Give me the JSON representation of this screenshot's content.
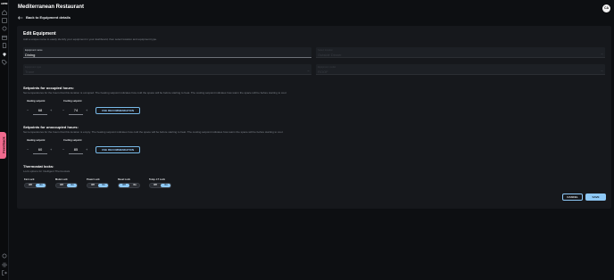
{
  "header": {
    "title": "Mediterranean Restaurant",
    "avatar_initials": "CA",
    "back_label": "Back to Equipment details"
  },
  "sidebar": {
    "logo": "AWM",
    "icons": [
      "home-icon",
      "dashboard-icon",
      "devices-icon",
      "calendar-icon",
      "document-icon",
      "location-icon",
      "tag-icon"
    ],
    "bottom_icons": [
      "help-icon",
      "settings-icon",
      "logout-icon"
    ]
  },
  "feedback_label": "Feedback",
  "form": {
    "heading": "Edit Equipment",
    "subtitle": "Add a unique name to easily identify your equipment in your dashboard, then select location and equipment type.",
    "name_label": "Equipment name",
    "name_value": "Dining",
    "location_label": "Select location",
    "location_value": "Outside Dinner",
    "type_label": "Equipment type",
    "type_value": "Trane",
    "model_label": "Equipment model",
    "model_value": "ROOF"
  },
  "occupied": {
    "heading": "Setpoints for occupied hours:",
    "desc": "Set temperatures for the hours that this location is occupied. The heating setpoint indicates how cold the space will be before starting to heat. The cooling setpoint indicates how warm the space will be before starting to cool.",
    "heating_label": "Heating setpoint",
    "heating_value": "68",
    "cooling_label": "Cooling setpoint",
    "cooling_value": "74",
    "rec_label": "USE RECOMMENDATION"
  },
  "unoccupied": {
    "heading": "Setpoints for unoccupied hours:",
    "desc": "Set temperatures for the hours that this location is empty. The heating setpoint indicates how cold the space will be before starting to heat. The cooling setpoint indicates how warm the space will be before starting to cool.",
    "heating_label": "Heating setpoint",
    "heating_value": "60",
    "cooling_label": "Cooling setpoint",
    "cooling_value": "85",
    "rec_label": "USE RECOMMENDATION"
  },
  "locks": {
    "heading": "Thermostat locks:",
    "desc": "Lock options for Intelligent Thermostats",
    "off_label": "Off",
    "on_label": "On",
    "items": [
      {
        "label": "Fan Lock",
        "state": "on"
      },
      {
        "label": "Mode Lock",
        "state": "on"
      },
      {
        "label": "Power Lock",
        "state": "on"
      },
      {
        "label": "Reset Lock",
        "state": "off"
      },
      {
        "label": "Temp. LT Lock",
        "state": "on"
      }
    ]
  },
  "actions": {
    "cancel_label": "CANCEL",
    "save_label": "SAVE"
  },
  "colors": {
    "accent": "#8ec9f7",
    "feedback": "#f06a8e",
    "background": "#0d0f12",
    "card": "#16181c"
  }
}
